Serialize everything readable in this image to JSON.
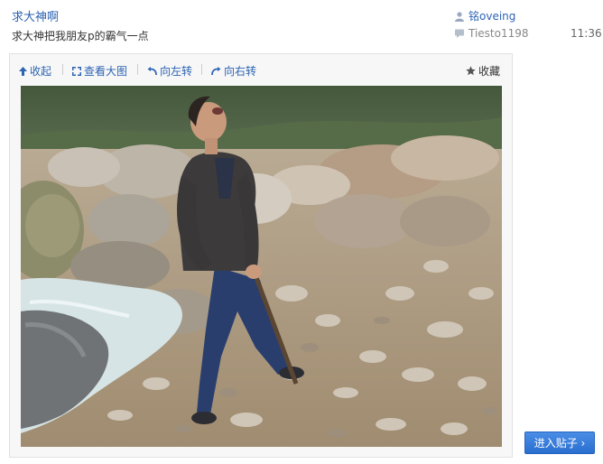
{
  "post": {
    "title": "求大神啊",
    "description": "求大神把我朋友p的霸气一点"
  },
  "meta": {
    "author_name": "铭oveing",
    "author_icon": "user-icon",
    "last_reply_name": "Tiesto1198",
    "last_reply_icon": "reply-icon",
    "last_reply_time": "11:36"
  },
  "toolbar": {
    "collapse_label": "收起",
    "view_large_label": "查看大图",
    "rotate_left_label": "向左转",
    "rotate_right_label": "向右转",
    "favorite_label": "收藏"
  },
  "enter_button_label": "进入贴子 ›",
  "colors": {
    "link_blue": "#2d64b3",
    "button_blue": "#2a6fd0"
  }
}
